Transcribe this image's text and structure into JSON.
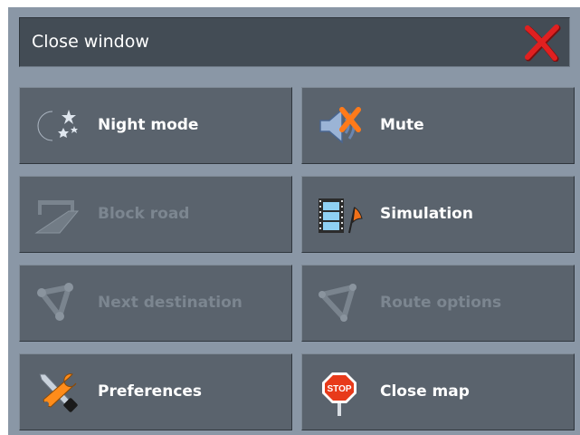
{
  "window": {
    "title": "Close window",
    "close_icon": "close-icon"
  },
  "buttons": [
    {
      "label": "Night mode",
      "icon": "moon-stars-icon",
      "enabled": true
    },
    {
      "label": "Mute",
      "icon": "speaker-mute-icon",
      "enabled": true
    },
    {
      "label": "Block road",
      "icon": "road-block-icon",
      "enabled": false
    },
    {
      "label": "Simulation",
      "icon": "film-flag-icon",
      "enabled": true
    },
    {
      "label": "Next destination",
      "icon": "route-waypoint-icon",
      "enabled": false
    },
    {
      "label": "Route options",
      "icon": "route-options-icon",
      "enabled": false
    },
    {
      "label": "Preferences",
      "icon": "tools-icon",
      "enabled": true
    },
    {
      "label": "Close map",
      "icon": "stop-sign-icon",
      "enabled": true
    }
  ],
  "colors": {
    "frame": "#8a97a6",
    "titlebar": "#434c55",
    "button": "#5a636d",
    "disabled_text": "#7c8690",
    "close_x": "#e02020"
  }
}
